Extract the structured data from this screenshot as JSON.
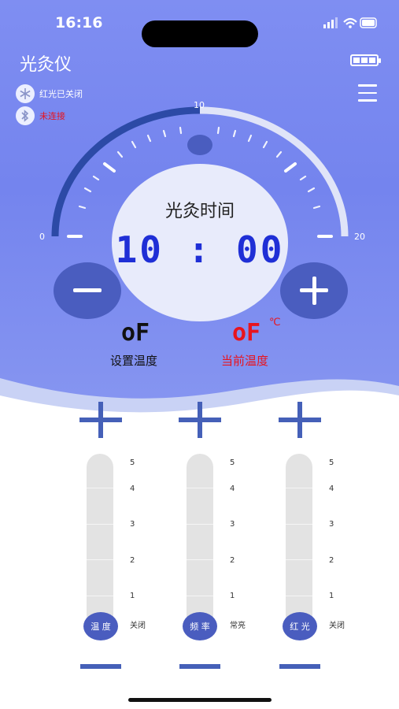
{
  "status_bar": {
    "time": "16:16"
  },
  "header": {
    "title": "光灸仪"
  },
  "status": {
    "red_light": "红光已关闭",
    "bluetooth": "未连接"
  },
  "gauge": {
    "min_label": "0",
    "mid_label": "10",
    "max_label": "20",
    "value": 10,
    "max": 20
  },
  "timer": {
    "title": "光灸时间",
    "value": "10 : 00"
  },
  "temperature": {
    "set_value": "oF",
    "set_label": "设置温度",
    "current_value": "oF",
    "current_unit": "℃",
    "current_label": "当前温度"
  },
  "sliders": [
    {
      "name": "温 度",
      "levels": [
        "5",
        "4",
        "3",
        "2",
        "1",
        "关闭"
      ]
    },
    {
      "name": "频 率",
      "levels": [
        "5",
        "4",
        "3",
        "2",
        "1",
        "常亮"
      ]
    },
    {
      "name": "红 光",
      "levels": [
        "5",
        "4",
        "3",
        "2",
        "1",
        "关闭"
      ]
    }
  ],
  "colors": {
    "accent": "#4a5dbf",
    "hero": "#7f8ef2",
    "digit_blue": "#1f2fd6",
    "alert_red": "#e8141e"
  }
}
